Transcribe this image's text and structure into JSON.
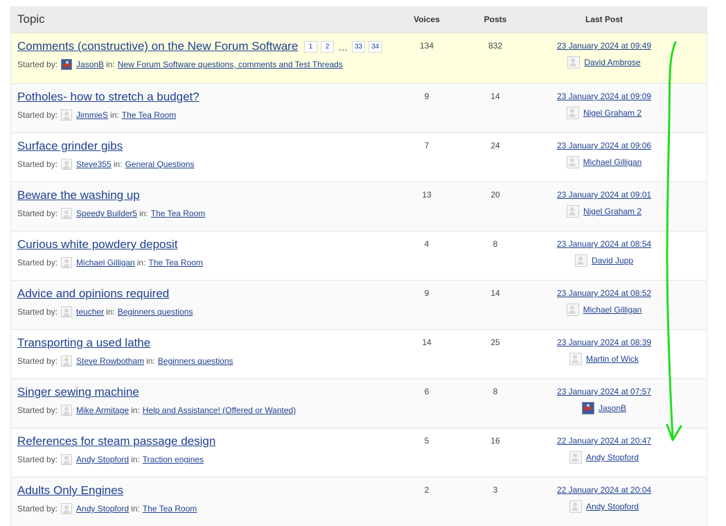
{
  "header": {
    "topic": "Topic",
    "voices": "Voices",
    "posts": "Posts",
    "last_post": "Last Post"
  },
  "labels": {
    "started_by": "Started by:",
    "in": "in:"
  },
  "topics": [
    {
      "title": "Comments (constructive) on the New Forum Software",
      "pages": [
        "1",
        "2",
        "…",
        "33",
        "34"
      ],
      "starter": "JasonB",
      "starter_avatar": "photo",
      "forum": "New Forum Software questions, comments and Test Threads",
      "voices": "134",
      "posts": "832",
      "last_date": "23 January 2024 at 09:49",
      "last_by": "David Ambrose",
      "last_avatar": "default",
      "sticky": true
    },
    {
      "title": "Potholes- how to stretch a budget?",
      "starter": "JimmieS",
      "starter_avatar": "default",
      "forum": "The Tea Room",
      "voices": "9",
      "posts": "14",
      "last_date": "23 January 2024 at 09:09",
      "last_by": "Nigel Graham 2",
      "last_avatar": "default"
    },
    {
      "title": "Surface grinder gibs",
      "starter": "Steve355",
      "starter_avatar": "default",
      "forum": "General Questions",
      "voices": "7",
      "posts": "24",
      "last_date": "23 January 2024 at 09:06",
      "last_by": "Michael Gilligan",
      "last_avatar": "default"
    },
    {
      "title": "Beware the washing up",
      "starter": "Speedy Builder5",
      "starter_avatar": "default",
      "forum": "The Tea Room",
      "voices": "13",
      "posts": "20",
      "last_date": "23 January 2024 at 09:01",
      "last_by": "Nigel Graham 2",
      "last_avatar": "default"
    },
    {
      "title": "Curious white powdery deposit",
      "starter": "Michael Gilligan",
      "starter_avatar": "default",
      "forum": "The Tea Room",
      "voices": "4",
      "posts": "8",
      "last_date": "23 January 2024 at 08:54",
      "last_by": "David Jupp",
      "last_avatar": "default"
    },
    {
      "title": "Advice and opinions required",
      "starter": "teucher",
      "starter_avatar": "default",
      "forum": "Beginners questions",
      "voices": "9",
      "posts": "14",
      "last_date": "23 January 2024 at 08:52",
      "last_by": "Michael Gilligan",
      "last_avatar": "default"
    },
    {
      "title": "Transporting a used lathe",
      "starter": "Steve Rowbotham",
      "starter_avatar": "default",
      "forum": "Beginners questions",
      "voices": "14",
      "posts": "25",
      "last_date": "23 January 2024 at 08:39",
      "last_by": "Martin of Wick",
      "last_avatar": "default"
    },
    {
      "title": "Singer sewing machine",
      "starter": "Mike Armitage",
      "starter_avatar": "default",
      "forum": "Help and Assistance! (Offered or Wanted)",
      "voices": "6",
      "posts": "8",
      "last_date": "23 January 2024 at 07:57",
      "last_by": "JasonB",
      "last_avatar": "photo"
    },
    {
      "title": "References for steam passage design",
      "starter": "Andy Stopford",
      "starter_avatar": "default",
      "forum": "Traction engines",
      "voices": "5",
      "posts": "16",
      "last_date": "22 January 2024 at 20:47",
      "last_by": "Andy Stopford",
      "last_avatar": "default"
    },
    {
      "title": "Adults Only Engines",
      "starter": "Andy Stopford",
      "starter_avatar": "default",
      "forum": "The Tea Room",
      "voices": "2",
      "posts": "3",
      "last_date": "22 January 2024 at 20:04",
      "last_by": "Andy Stopford",
      "last_avatar": "default"
    }
  ],
  "colors": {
    "link": "#1d3f8f",
    "sticky_bg": "#ffffe0",
    "header_bg": "#ececec",
    "arrow": "#22dd22"
  }
}
